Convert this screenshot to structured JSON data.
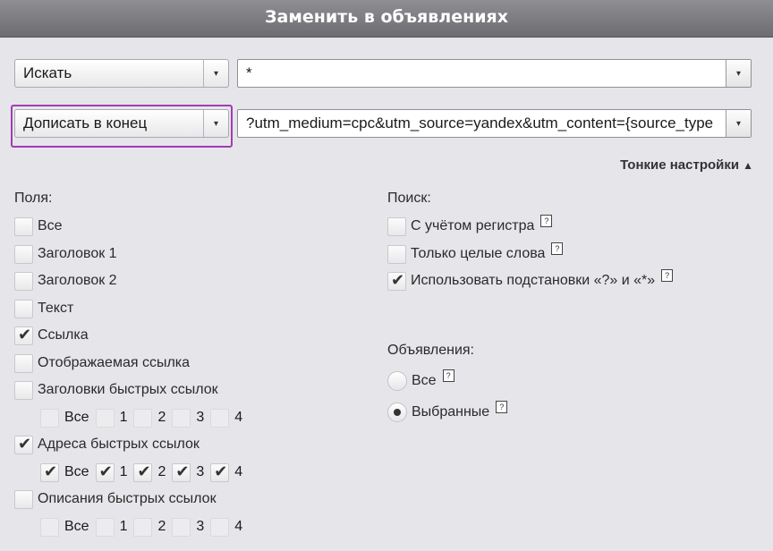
{
  "dialog": {
    "title": "Заменить в объявлениях"
  },
  "find_mode": {
    "selected": "Искать",
    "arrow": "▾"
  },
  "find_value": {
    "value": "*",
    "arrow": "▾"
  },
  "action_mode": {
    "selected": "Дописать в конец",
    "arrow": "▾"
  },
  "action_value": {
    "value": "?utm_medium=cpc&utm_source=yandex&utm_content={source_type",
    "arrow": "▾"
  },
  "fine_settings": {
    "label": "Тонкие настройки",
    "arrow": "▲"
  },
  "fields": {
    "label": "Поля:",
    "items": [
      {
        "label": "Все",
        "checked": false
      },
      {
        "label": "Заголовок 1",
        "checked": false
      },
      {
        "label": "Заголовок 2",
        "checked": false
      },
      {
        "label": "Текст",
        "checked": false
      },
      {
        "label": "Ссылка",
        "checked": true
      },
      {
        "label": "Отображаемая ссылка",
        "checked": false
      },
      {
        "label": "Заголовки быстрых ссылок",
        "checked": false
      },
      {
        "label": "Адреса быстрых ссылок",
        "checked": true
      },
      {
        "label": "Описания быстрых ссылок",
        "checked": false
      }
    ],
    "sitelink_titles_sub": [
      "Все",
      "1",
      "2",
      "3",
      "4"
    ],
    "sitelink_urls_sub": [
      "Все",
      "1",
      "2",
      "3",
      "4"
    ],
    "sitelink_desc_sub": [
      "Все",
      "1",
      "2",
      "3",
      "4"
    ]
  },
  "search": {
    "label": "Поиск:",
    "items": [
      {
        "label": "С учётом регистра",
        "checked": false
      },
      {
        "label": "Только целые слова",
        "checked": false
      },
      {
        "label": "Использовать подстановки «?» и «*»",
        "checked": true
      }
    ],
    "help": "?"
  },
  "ads": {
    "label": "Объявления:",
    "options": [
      {
        "label": "Все",
        "selected": false
      },
      {
        "label": "Выбранные",
        "selected": true
      }
    ]
  }
}
